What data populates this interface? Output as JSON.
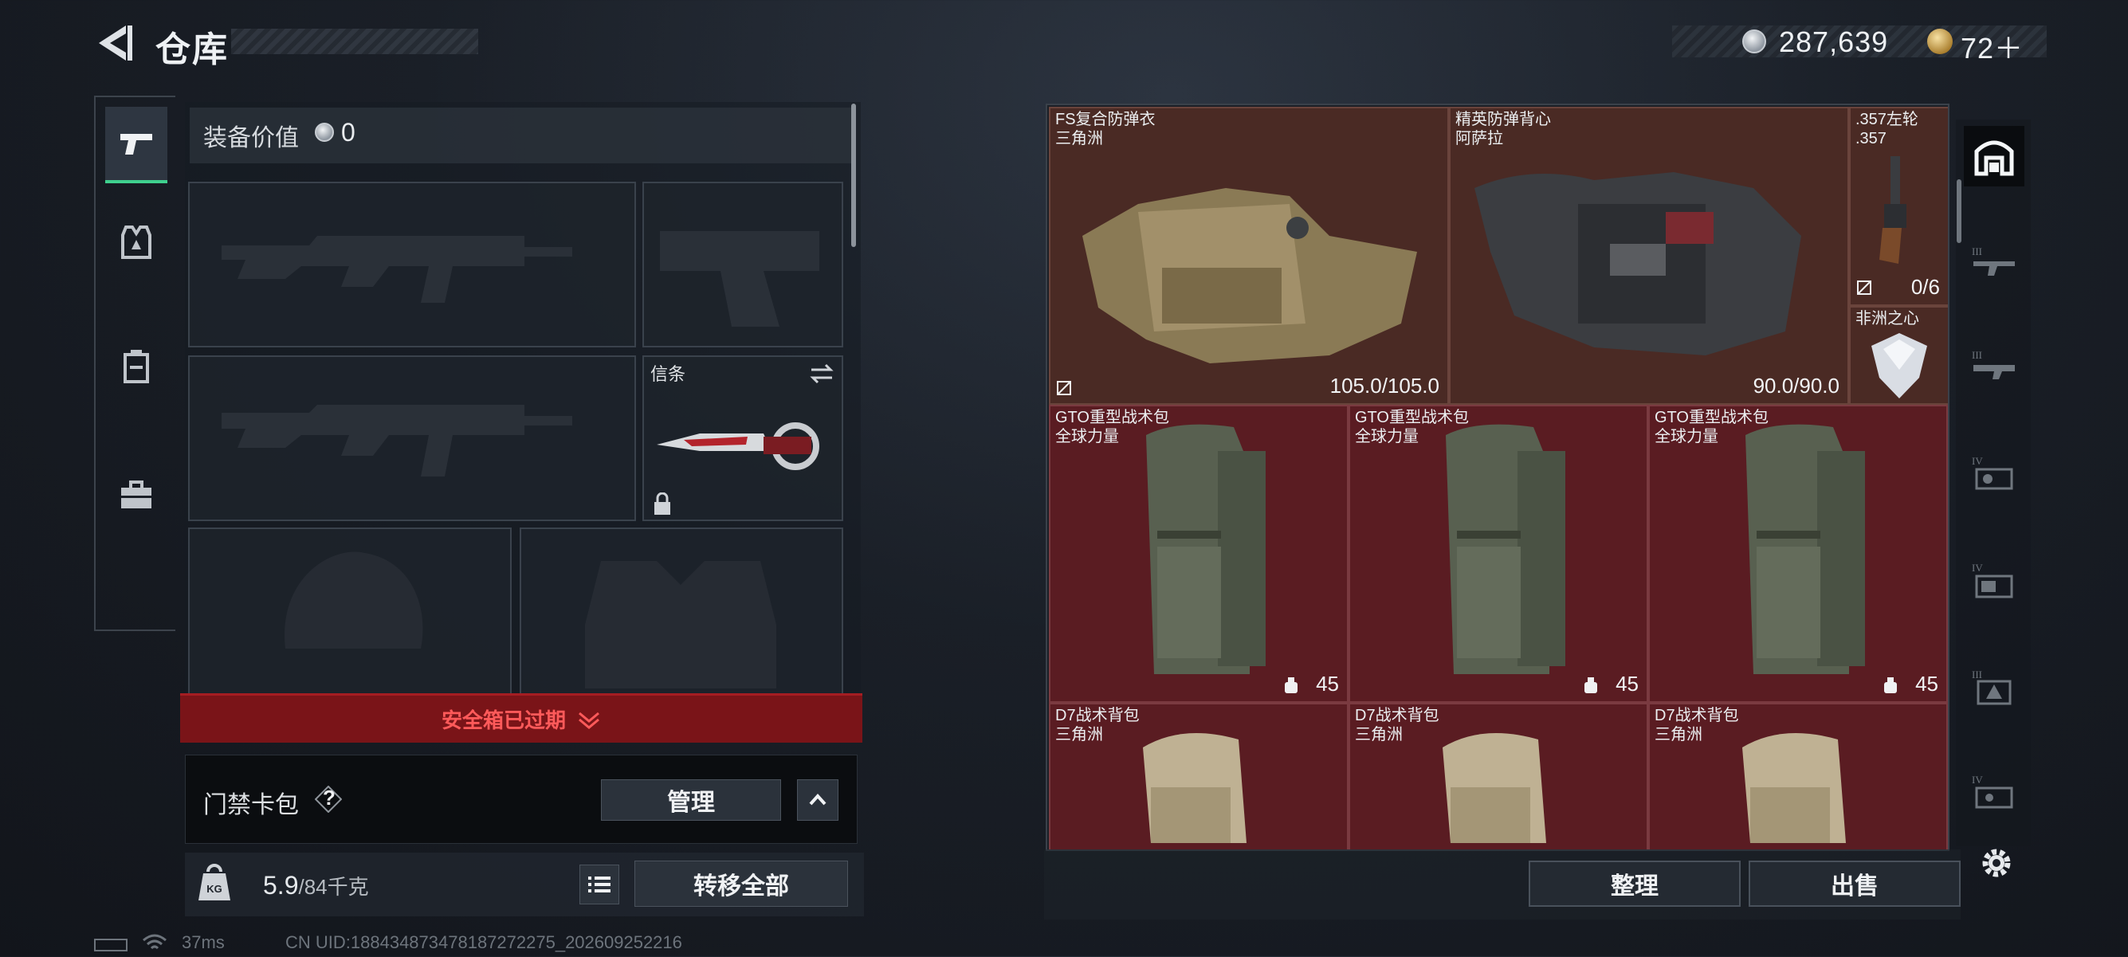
{
  "header": {
    "title": "仓库",
    "currency_coins": "287,639",
    "currency_gold": "72＋"
  },
  "loadout": {
    "equipment_value_label": "装备价值",
    "equipment_value": "0",
    "melee_label": "信条",
    "safe_box_expired": "安全箱已过期",
    "card_pack_label": "门禁卡包",
    "card_pack_help": "?",
    "manage_label": "管理",
    "weight_current": "5.9",
    "weight_max": "/84千克",
    "transfer_all_label": "转移全部"
  },
  "storage": {
    "items": [
      {
        "name": "FS复合防弹衣",
        "brand": "三角洲",
        "stat": "105.0/105.0"
      },
      {
        "name": "精英防弹背心",
        "brand": "阿萨拉",
        "stat": "90.0/90.0"
      },
      {
        "name": ".357左轮",
        "brand": ".357",
        "stat": "0/6"
      },
      {
        "name": "非洲之心",
        "brand": "",
        "stat": ""
      },
      {
        "name": "GTO重型战术包",
        "brand": "全球力量",
        "stat": "45"
      },
      {
        "name": "GTO重型战术包",
        "brand": "全球力量",
        "stat": "45"
      },
      {
        "name": "GTO重型战术包",
        "brand": "全球力量",
        "stat": "45"
      },
      {
        "name": "D7战术背包",
        "brand": "三角洲",
        "stat": ""
      },
      {
        "name": "D7战术背包",
        "brand": "三角洲",
        "stat": ""
      },
      {
        "name": "D7战术背包",
        "brand": "三角洲",
        "stat": ""
      }
    ],
    "sort_label": "整理",
    "sell_label": "出售"
  },
  "rail": {
    "tiers": [
      "III",
      "III",
      "IV",
      "IV",
      "III",
      "IV"
    ]
  },
  "status": {
    "ping": "37ms",
    "uid": "CN UID:18843487347818727227​5_202609252216"
  },
  "colors": {
    "accent_green": "#3fd08e",
    "alert_red": "#ff5a5a",
    "cell_red": "#5a1c22"
  }
}
